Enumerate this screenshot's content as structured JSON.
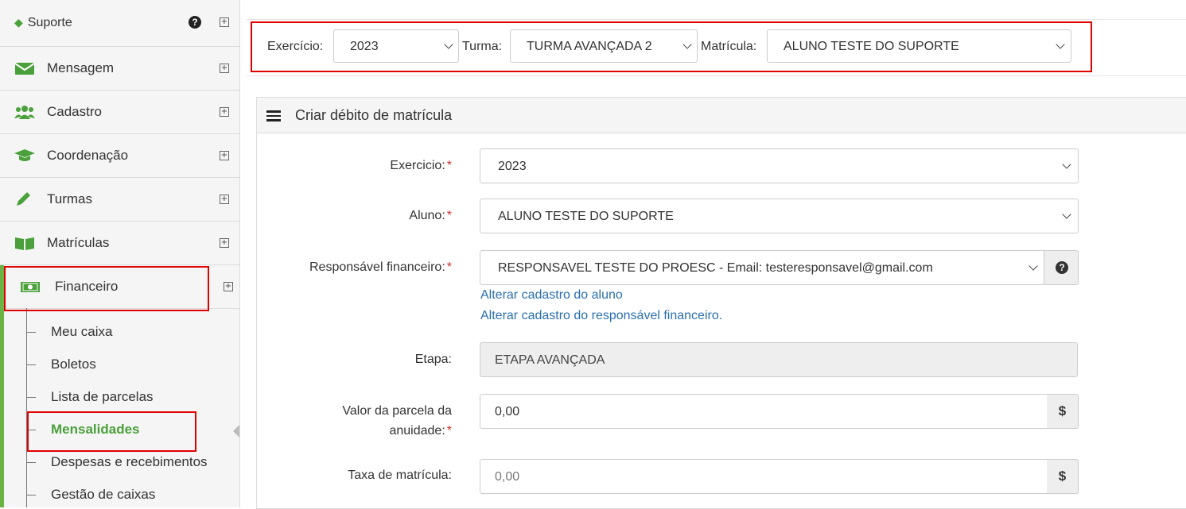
{
  "sidebar": {
    "top_label": "Suporte",
    "items": [
      {
        "label": "Mensagem",
        "icon": "envelope-icon"
      },
      {
        "label": "Cadastro",
        "icon": "users-icon"
      },
      {
        "label": "Coordenação",
        "icon": "graduation-cap-icon"
      },
      {
        "label": "Turmas",
        "icon": "pencil-icon"
      },
      {
        "label": "Matrículas",
        "icon": "book-icon"
      },
      {
        "label": "Financeiro",
        "icon": "money-icon"
      }
    ],
    "submenu": [
      "Meu caixa",
      "Boletos",
      "Lista de parcelas",
      "Mensalidades",
      "Despesas e recebimentos",
      "Gestão de caixas"
    ],
    "active_submenu": "Mensalidades"
  },
  "filters": {
    "exercicio_label": "Exercício:",
    "exercicio_value": "2023",
    "turma_label": "Turma:",
    "turma_value": "TURMA AVANÇADA 2",
    "matricula_label": "Matrícula:",
    "matricula_value": "ALUNO TESTE DO SUPORTE"
  },
  "panel": {
    "title": "Criar débito de matrícula",
    "fields": {
      "exercicio_label": "Exercicio:",
      "exercicio_value": "2023",
      "aluno_label": "Aluno:",
      "aluno_value": "ALUNO TESTE DO SUPORTE",
      "responsavel_label": "Responsável financeiro:",
      "responsavel_value": "RESPONSAVEL TESTE DO PROESC - Email: testeresponsavel@gmail.com",
      "link_aluno": "Alterar cadastro do aluno",
      "link_responsavel": "Alterar cadastro do responsável financeiro.",
      "etapa_label": "Etapa:",
      "etapa_value": "ETAPA AVANÇADA",
      "valor_label_1": "Valor da parcela da",
      "valor_label_2": "anuidade:",
      "valor_value": "0,00",
      "taxa_label": "Taxa de matrícula:",
      "taxa_placeholder": "0,00",
      "currency_symbol": "$",
      "required_mark": "*"
    }
  },
  "colors": {
    "accent_green": "#4aa03a",
    "highlight_red": "#e00000",
    "link_blue": "#2a6fb0"
  }
}
